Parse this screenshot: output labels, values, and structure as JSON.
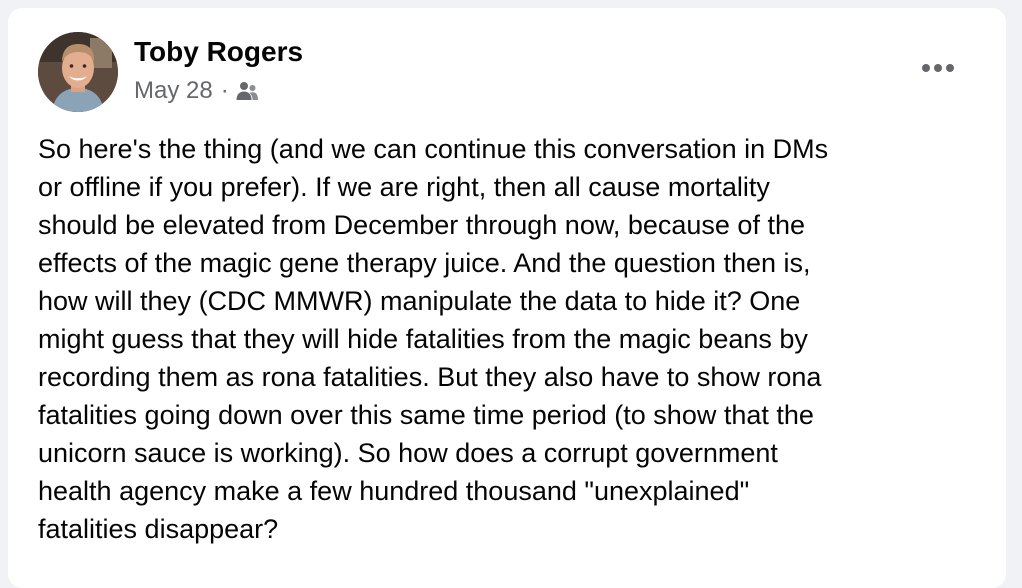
{
  "post": {
    "author": "Toby Rogers",
    "date": "May 28",
    "separator": "·",
    "audience_icon": "friends-icon",
    "more_icon": "more-options-icon",
    "body_lines": [
      "So here's the thing (and we can continue this conversation in DMs",
      "or offline if you prefer). If we are right, then all cause mortality",
      "should be elevated from December through now, because of the",
      "effects of the magic gene therapy juice. And the question then is,",
      "how will they (CDC MMWR) manipulate the data to hide it? One",
      "might guess that they will hide fatalities from the magic beans by",
      "recording them as rona fatalities. But they also have to show rona",
      "fatalities going down over this same time period (to show that the",
      "unicorn sauce is working). So how does a corrupt government",
      "health agency make a few hundred thousand \"unexplained\"",
      "fatalities disappear?"
    ]
  },
  "colors": {
    "page_background": "#f0f2f5",
    "card_background": "#ffffff",
    "primary_text": "#050505",
    "secondary_text": "#65676b"
  }
}
